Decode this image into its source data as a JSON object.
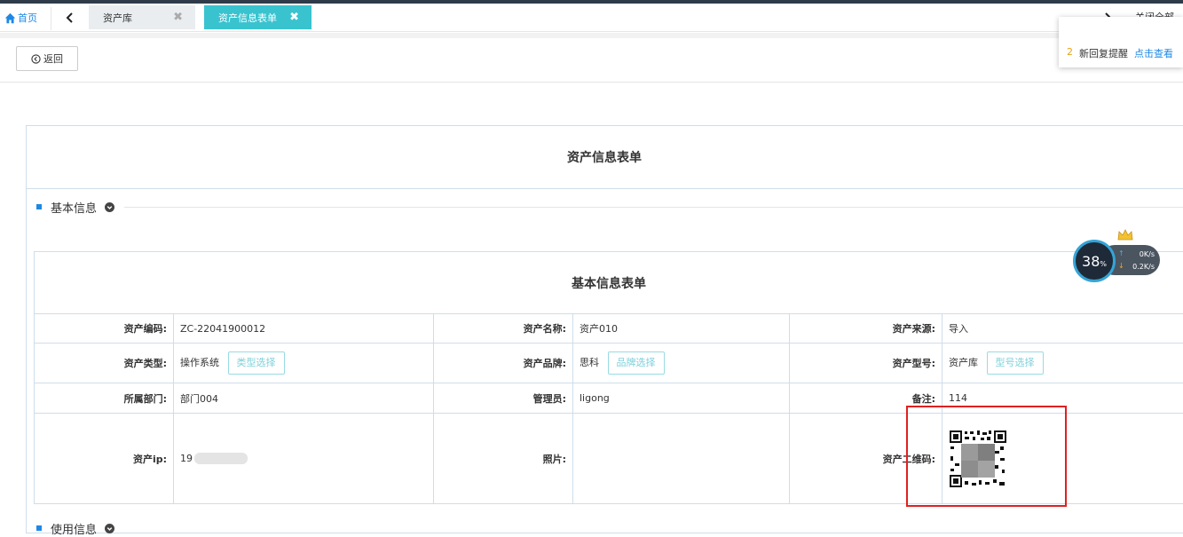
{
  "tabs": {
    "home_label": "首页",
    "items": [
      {
        "label": "资产库"
      },
      {
        "label": "资产信息表单"
      }
    ],
    "close_all_label": "关闭全部"
  },
  "toolbar": {
    "back_label": "返回"
  },
  "notification": {
    "count": "2",
    "text": "新回复提醒",
    "link": "点击查看"
  },
  "form": {
    "title": "资产信息表单",
    "section_basic": "基本信息",
    "section_usage": "使用信息",
    "table_title": "基本信息表单",
    "rows": [
      [
        {
          "label": "资产编码:",
          "value": "ZC-22041900012"
        },
        {
          "label": "资产名称:",
          "value": "资产010"
        },
        {
          "label": "资产来源:",
          "value": "导入"
        }
      ],
      [
        {
          "label": "资产类型:",
          "value": "操作系统",
          "button": "类型选择"
        },
        {
          "label": "资产品牌:",
          "value": "思科",
          "button": "品牌选择"
        },
        {
          "label": "资产型号:",
          "value": "资产库",
          "button": "型号选择"
        }
      ],
      [
        {
          "label": "所属部门:",
          "value": "部门004"
        },
        {
          "label": "管理员:",
          "value": "ligong"
        },
        {
          "label": "备注:",
          "value": "114"
        }
      ],
      [
        {
          "label": "资产ip:",
          "value": "19"
        },
        {
          "label": "照片:",
          "value": ""
        },
        {
          "label": "资产二维码:",
          "value": ""
        }
      ]
    ]
  },
  "speed_widget": {
    "percent": "38",
    "percent_unit": "%",
    "upload": "0K/s",
    "download": "0.2K/s"
  },
  "colors": {
    "accent_tab": "#38c3cf",
    "link_blue": "#1e88e5",
    "highlight_red": "#e02020",
    "border": "#cfdde9"
  }
}
